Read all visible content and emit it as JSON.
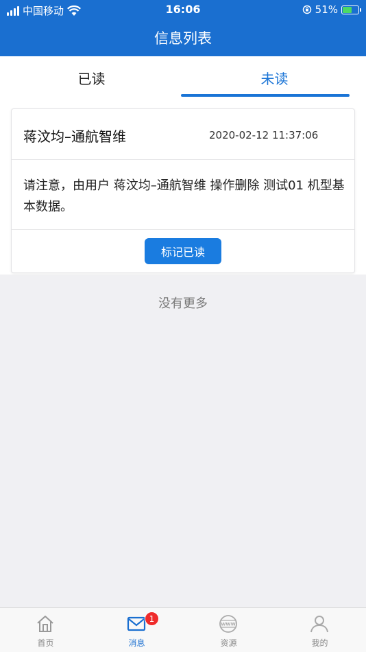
{
  "status_bar": {
    "carrier": "中国移动",
    "time": "16:06",
    "battery": "51%"
  },
  "header": {
    "title": "信息列表"
  },
  "tabs": [
    {
      "label": "已读",
      "active": false
    },
    {
      "label": "未读",
      "active": true
    }
  ],
  "message": {
    "title": "蒋汶均–通航智维",
    "time": "2020-02-12 11:37:06",
    "content": "请注意，由用户 蒋汶均–通航智维 操作删除 测试01 机型基本数据。",
    "button_label": "标记已读"
  },
  "list_footer": "没有更多",
  "bottom_nav": [
    {
      "label": "首页",
      "icon": "home-icon"
    },
    {
      "label": "消息",
      "icon": "mail-icon",
      "badge": "1",
      "active": true
    },
    {
      "label": "资源",
      "icon": "www-icon"
    },
    {
      "label": "我的",
      "icon": "user-icon"
    }
  ],
  "colors": {
    "primary": "#1a6fd0",
    "badge": "#ef2b2b"
  }
}
